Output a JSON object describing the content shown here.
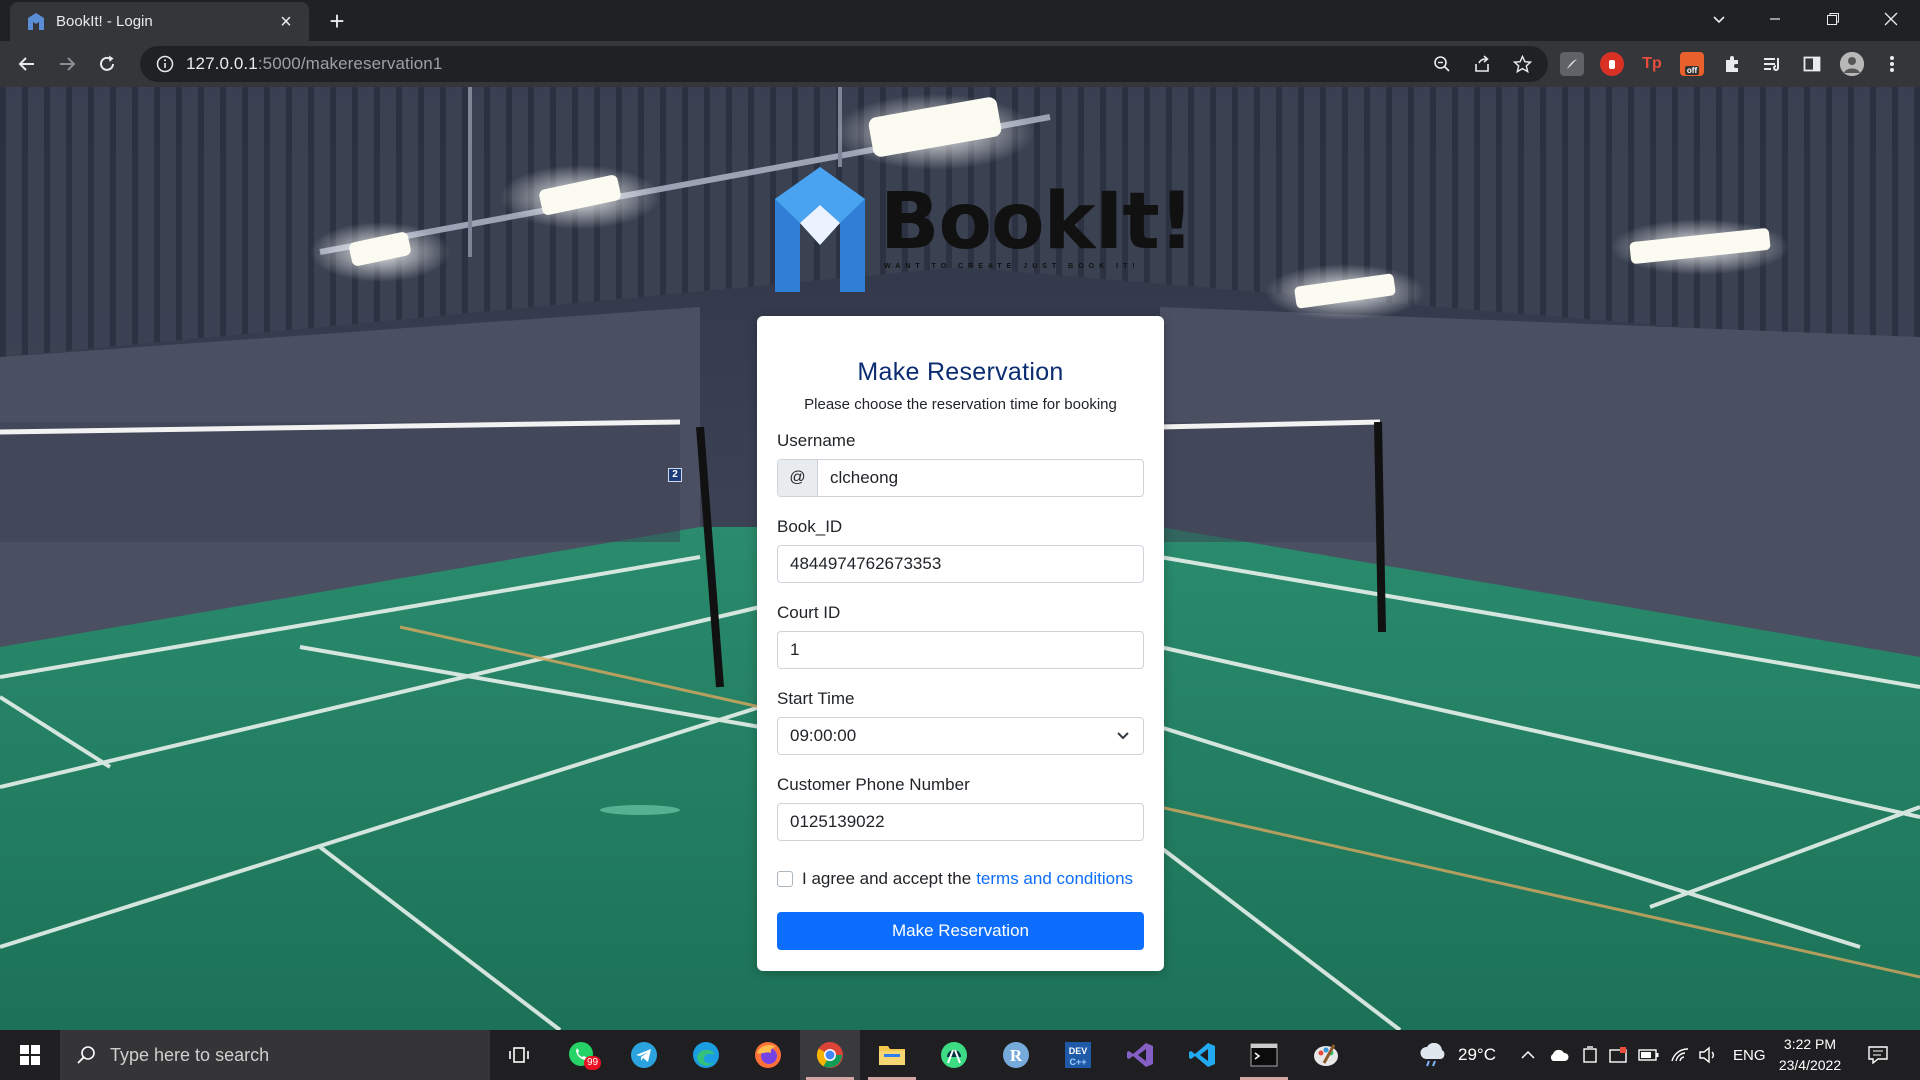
{
  "browser": {
    "tab_title": "BookIt! - Login",
    "url_host": "127.0.0.1",
    "url_path": ":5000/makereservation1",
    "ext_tp_label": "Tp",
    "ext_off_label": "off"
  },
  "logo": {
    "brand": "BookIt!",
    "tagline": "WANT TO CREATE JUST BOOK IT!"
  },
  "court_marker": "2",
  "form": {
    "title": "Make Reservation",
    "subtitle": "Please choose the reservation time for booking",
    "username_label": "Username",
    "username_addon": "@",
    "username_value": "clcheong",
    "book_id_label": "Book_ID",
    "book_id_value": "4844974762673353",
    "court_id_label": "Court ID",
    "court_id_value": "1",
    "start_time_label": "Start Time",
    "start_time_value": "09:00:00",
    "phone_label": "Customer Phone Number",
    "phone_value": "0125139022",
    "agree_text": "I agree and accept the",
    "terms_link": "terms and conditions",
    "agree_checked": false,
    "submit_label": "Make Reservation"
  },
  "taskbar": {
    "search_placeholder": "Type here to search",
    "whatsapp_badge": "99",
    "weather": "29°C",
    "language": "ENG",
    "time": "3:22 PM",
    "date": "23/4/2022"
  },
  "colors": {
    "primary": "#0d6efd",
    "title": "#0b2c70",
    "court_green": "#1f8a63"
  }
}
